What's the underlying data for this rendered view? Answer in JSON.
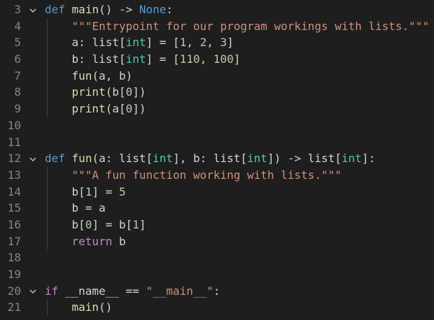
{
  "editor": {
    "lines": [
      {
        "number": "3",
        "foldable": true,
        "indent": 0,
        "tokens": [
          {
            "t": "def",
            "c": "kw"
          },
          {
            "t": " ",
            "c": "pun"
          },
          {
            "t": "main",
            "c": "fn"
          },
          {
            "t": "() -> ",
            "c": "pun"
          },
          {
            "t": "None",
            "c": "kw"
          },
          {
            "t": ":",
            "c": "pun"
          }
        ]
      },
      {
        "number": "4",
        "foldable": false,
        "indent": 1,
        "tokens": [
          {
            "t": "\"\"\"Entrypoint for our program workings with lists.\"\"\"",
            "c": "str"
          }
        ]
      },
      {
        "number": "5",
        "foldable": false,
        "indent": 1,
        "tokens": [
          {
            "t": "a",
            "c": "var"
          },
          {
            "t": ": list[",
            "c": "pun"
          },
          {
            "t": "int",
            "c": "ty"
          },
          {
            "t": "] = [",
            "c": "pun"
          },
          {
            "t": "1",
            "c": "num"
          },
          {
            "t": ", ",
            "c": "pun"
          },
          {
            "t": "2",
            "c": "num"
          },
          {
            "t": ", ",
            "c": "pun"
          },
          {
            "t": "3",
            "c": "num"
          },
          {
            "t": "]",
            "c": "pun"
          }
        ]
      },
      {
        "number": "6",
        "foldable": false,
        "indent": 1,
        "tokens": [
          {
            "t": "b",
            "c": "var"
          },
          {
            "t": ": list[",
            "c": "pun"
          },
          {
            "t": "int",
            "c": "ty"
          },
          {
            "t": "] = [",
            "c": "pun"
          },
          {
            "t": "110",
            "c": "num"
          },
          {
            "t": ", ",
            "c": "pun"
          },
          {
            "t": "100",
            "c": "num"
          },
          {
            "t": "]",
            "c": "pun"
          }
        ]
      },
      {
        "number": "7",
        "foldable": false,
        "indent": 1,
        "tokens": [
          {
            "t": "fun",
            "c": "fn"
          },
          {
            "t": "(a, b)",
            "c": "pun"
          }
        ]
      },
      {
        "number": "8",
        "foldable": false,
        "indent": 1,
        "tokens": [
          {
            "t": "print",
            "c": "fn"
          },
          {
            "t": "(b[",
            "c": "pun"
          },
          {
            "t": "0",
            "c": "num"
          },
          {
            "t": "])",
            "c": "pun"
          }
        ]
      },
      {
        "number": "9",
        "foldable": false,
        "indent": 1,
        "tokens": [
          {
            "t": "print",
            "c": "fn"
          },
          {
            "t": "(a[",
            "c": "pun"
          },
          {
            "t": "0",
            "c": "num"
          },
          {
            "t": "])",
            "c": "pun"
          }
        ]
      },
      {
        "number": "10",
        "foldable": false,
        "indent": 0,
        "tokens": []
      },
      {
        "number": "11",
        "foldable": false,
        "indent": 0,
        "tokens": []
      },
      {
        "number": "12",
        "foldable": true,
        "indent": 0,
        "tokens": [
          {
            "t": "def",
            "c": "kw"
          },
          {
            "t": " ",
            "c": "pun"
          },
          {
            "t": "fun",
            "c": "fn"
          },
          {
            "t": "(a: list[",
            "c": "pun"
          },
          {
            "t": "int",
            "c": "ty"
          },
          {
            "t": "], b: list[",
            "c": "pun"
          },
          {
            "t": "int",
            "c": "ty"
          },
          {
            "t": "]) -> list[",
            "c": "pun"
          },
          {
            "t": "int",
            "c": "ty"
          },
          {
            "t": "]:",
            "c": "pun"
          }
        ]
      },
      {
        "number": "13",
        "foldable": false,
        "indent": 1,
        "tokens": [
          {
            "t": "\"\"\"A fun function working with lists.\"\"\"",
            "c": "str"
          }
        ]
      },
      {
        "number": "14",
        "foldable": false,
        "indent": 1,
        "tokens": [
          {
            "t": "b[",
            "c": "pun"
          },
          {
            "t": "1",
            "c": "num"
          },
          {
            "t": "] = ",
            "c": "pun"
          },
          {
            "t": "5",
            "c": "num"
          }
        ]
      },
      {
        "number": "15",
        "foldable": false,
        "indent": 1,
        "tokens": [
          {
            "t": "b = a",
            "c": "pun"
          }
        ]
      },
      {
        "number": "16",
        "foldable": false,
        "indent": 1,
        "tokens": [
          {
            "t": "b[",
            "c": "pun"
          },
          {
            "t": "0",
            "c": "num"
          },
          {
            "t": "] = b[",
            "c": "pun"
          },
          {
            "t": "1",
            "c": "num"
          },
          {
            "t": "]",
            "c": "pun"
          }
        ]
      },
      {
        "number": "17",
        "foldable": false,
        "indent": 1,
        "tokens": [
          {
            "t": "return",
            "c": "ctl"
          },
          {
            "t": " b",
            "c": "pun"
          }
        ]
      },
      {
        "number": "18",
        "foldable": false,
        "indent": 0,
        "tokens": []
      },
      {
        "number": "19",
        "foldable": false,
        "indent": 0,
        "tokens": []
      },
      {
        "number": "20",
        "foldable": true,
        "indent": 0,
        "tokens": [
          {
            "t": "if",
            "c": "ctl"
          },
          {
            "t": " __name__ == ",
            "c": "pun"
          },
          {
            "t": "\"__main__\"",
            "c": "str"
          },
          {
            "t": ":",
            "c": "pun"
          }
        ]
      },
      {
        "number": "21",
        "foldable": false,
        "indent": 1,
        "tokens": [
          {
            "t": "main",
            "c": "fn"
          },
          {
            "t": "()",
            "c": "pun"
          }
        ]
      }
    ]
  },
  "colors": {
    "background": "#1e1e1e",
    "line_number": "#858585",
    "keyword": "#569cd6",
    "control": "#c586c0",
    "function": "#dcdcaa",
    "type": "#4ec9b0",
    "string": "#ce9178",
    "number": "#b5cea8",
    "text": "#d4d4d4"
  },
  "icons": {
    "fold": "chevron-down-icon"
  }
}
